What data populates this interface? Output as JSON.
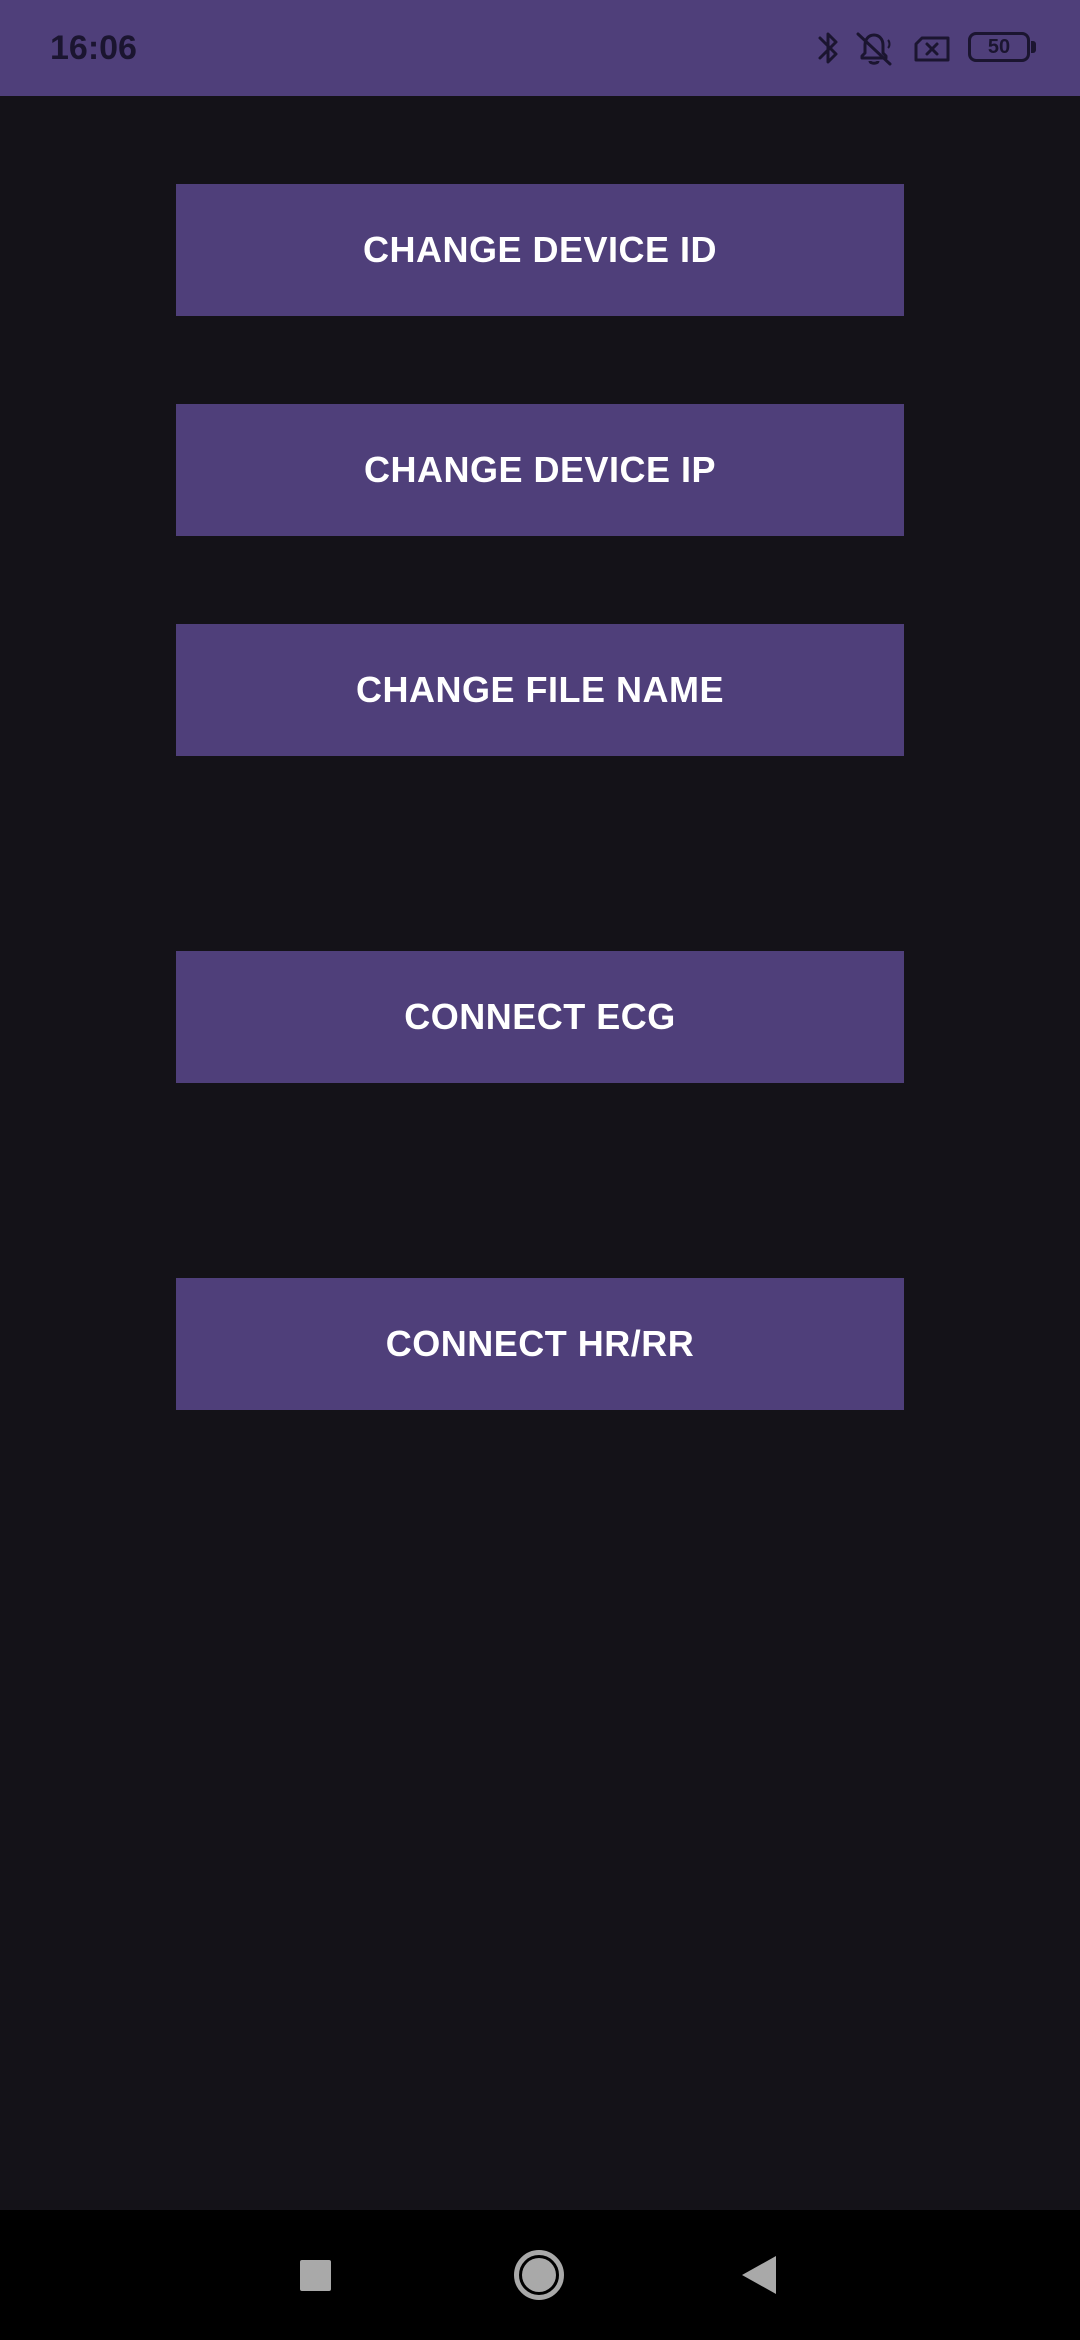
{
  "status_bar": {
    "time": "16:06",
    "icons": [
      "bluetooth-icon",
      "notifications-off-icon",
      "no-sim-icon",
      "battery-icon"
    ],
    "battery_level": "50",
    "background_color": "#4f3f7a"
  },
  "main": {
    "buttons": [
      {
        "label": "CHANGE DEVICE ID"
      },
      {
        "label": "CHANGE DEVICE IP"
      },
      {
        "label": "CHANGE FILE NAME"
      },
      {
        "label": "CONNECT ECG"
      },
      {
        "label": "CONNECT HR/RR"
      }
    ],
    "button_color": "#4f3f7a",
    "background_color": "#141218"
  },
  "nav_bar": {
    "icons": [
      "recents-icon",
      "home-icon",
      "back-icon"
    ]
  }
}
